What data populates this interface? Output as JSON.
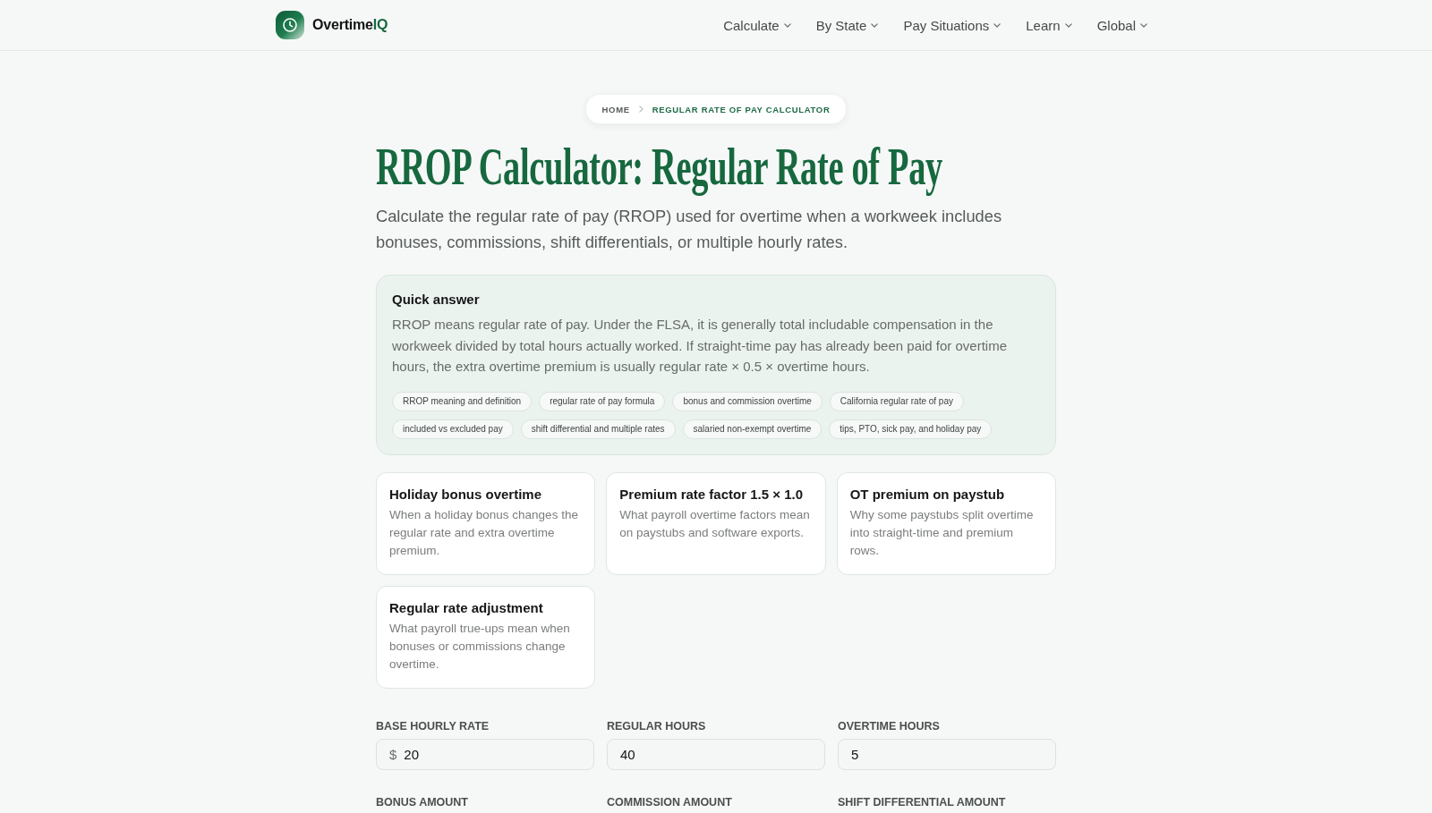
{
  "header": {
    "brand": {
      "name": "Overtime",
      "accent": "IQ"
    },
    "nav": [
      {
        "label": "Calculate"
      },
      {
        "label": "By State"
      },
      {
        "label": "Pay Situations"
      },
      {
        "label": "Learn"
      },
      {
        "label": "Global"
      }
    ]
  },
  "breadcrumb": [
    {
      "label": "HOME",
      "current": false
    },
    {
      "label": "REGULAR RATE OF PAY CALCULATOR",
      "current": true
    }
  ],
  "title": "RROP Calculator: Regular Rate of Pay",
  "intro": "Calculate the regular rate of pay (RROP) used for overtime when a workweek includes bonuses, commissions, shift differentials, or multiple hourly rates.",
  "quick_answer": {
    "heading": "Quick answer",
    "text": "RROP means regular rate of pay. Under the FLSA, it is generally total includable compensation in the workweek divided by total hours actually worked. If straight-time pay has already been paid for overtime hours, the extra overtime premium is usually regular rate × 0.5 × overtime hours.",
    "tags": [
      "RROP meaning and definition",
      "regular rate of pay formula",
      "bonus and commission overtime",
      "California regular rate of pay",
      "included vs excluded pay",
      "shift differential and multiple rates",
      "salaried non-exempt overtime",
      "tips, PTO, sick pay, and holiday pay"
    ]
  },
  "cards": [
    {
      "title": "Holiday bonus overtime",
      "text": "When a holiday bonus changes the regular rate and extra overtime premium."
    },
    {
      "title": "Premium rate factor 1.5 × 1.0",
      "text": "What payroll overtime factors mean on paystubs and software exports."
    },
    {
      "title": "OT premium on paystub",
      "text": "Why some paystubs split overtime into straight-time and premium rows."
    },
    {
      "title": "Regular rate adjustment",
      "text": "What payroll true-ups mean when bonuses or commissions change overtime."
    }
  ],
  "form": {
    "fields": [
      {
        "label": "BASE HOURLY RATE",
        "prefix": "$",
        "value": "20"
      },
      {
        "label": "REGULAR HOURS",
        "value": "40"
      },
      {
        "label": "OVERTIME HOURS",
        "value": "5"
      },
      {
        "label": "BONUS AMOUNT"
      },
      {
        "label": "COMMISSION AMOUNT"
      },
      {
        "label": "SHIFT DIFFERENTIAL AMOUNT"
      }
    ]
  }
}
